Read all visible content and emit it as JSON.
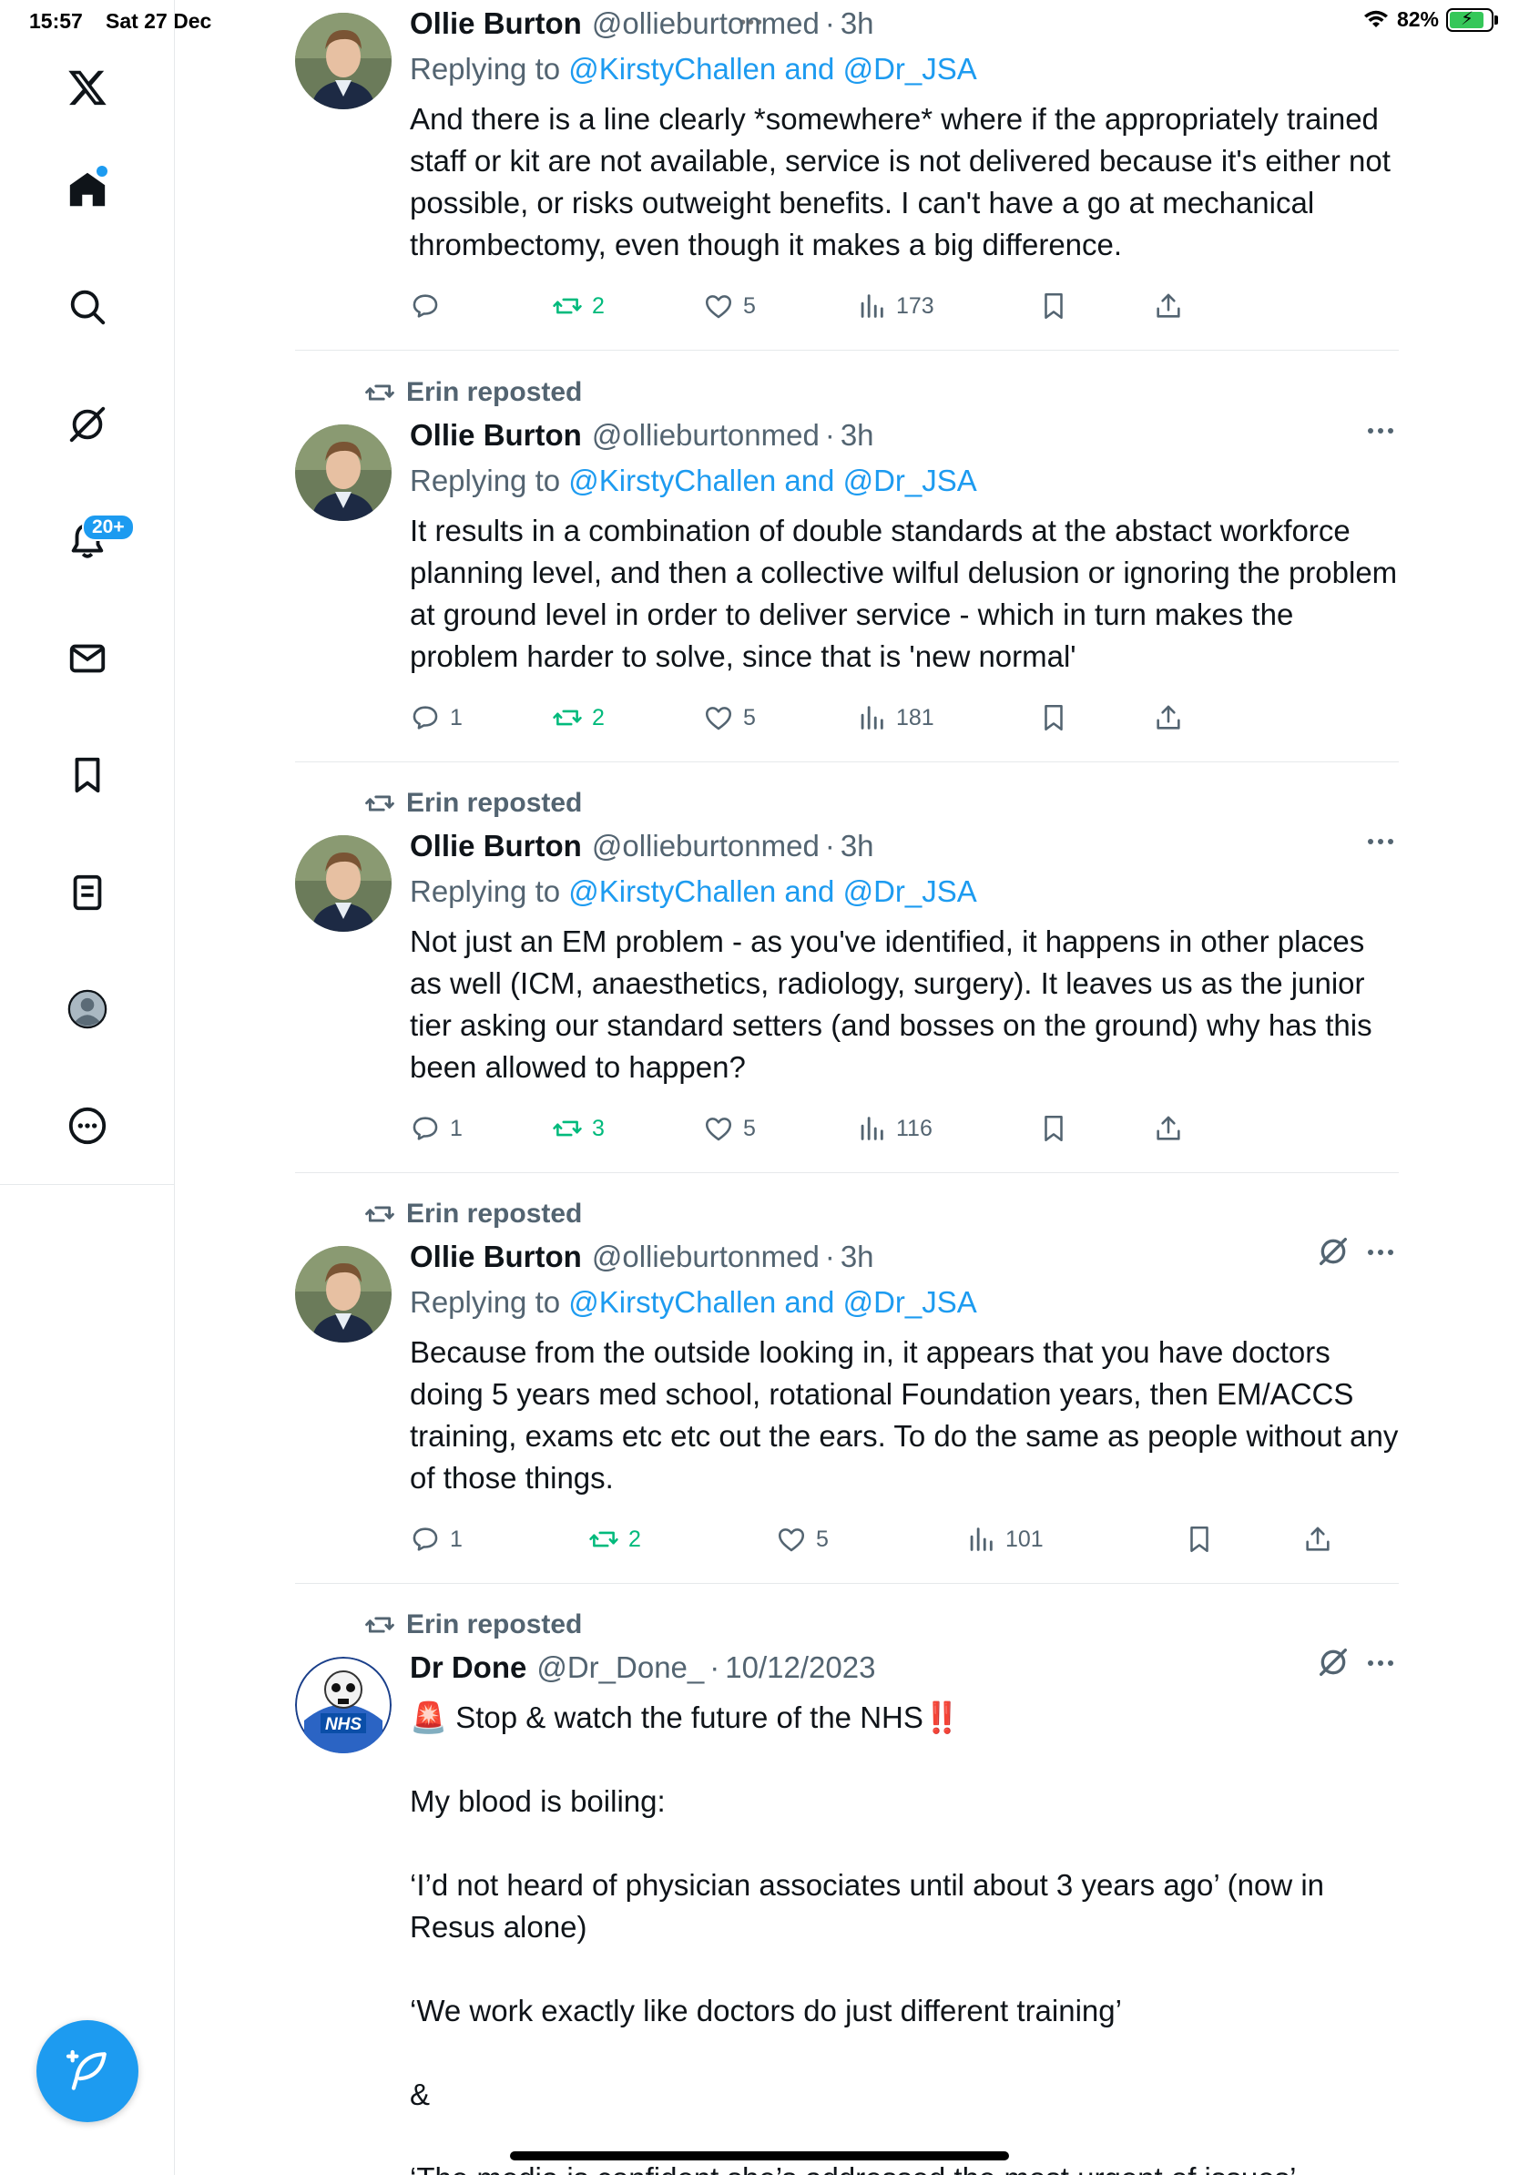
{
  "status": {
    "time": "15:57",
    "date": "Sat 27 Dec",
    "battery": "82%"
  },
  "nav": {
    "items": [
      "x-logo",
      "home",
      "search",
      "grok",
      "notifications",
      "messages",
      "bookmarks",
      "lists",
      "profile",
      "more"
    ],
    "notif_badge": "20+"
  },
  "tweets": [
    {
      "reposted_by": "",
      "name": "Ollie Burton",
      "handle": "@ollieburtonmed",
      "time": "3h",
      "reply_prefix": "Replying to ",
      "reply_to": "@KirstyChallen and @Dr_JSA",
      "text": "And there is a line clearly *somewhere* where if the appropriately trained staff or kit are not available, service is not delivered because it's either not possible, or risks outweight benefits. I can't have a go at mechanical thrombectomy, even though it makes a big difference.",
      "replies": "",
      "reposts": "2",
      "likes": "5",
      "views": "173"
    },
    {
      "reposted_by": "Erin reposted",
      "name": "Ollie Burton",
      "handle": "@ollieburtonmed",
      "time": "3h",
      "reply_prefix": "Replying to ",
      "reply_to": "@KirstyChallen and @Dr_JSA",
      "text": "It results in a combination of double standards at the abstact workforce planning level, and then a collective wilful delusion or ignoring the problem at ground level in order to deliver service - which in turn makes the problem harder to solve, since that is 'new normal'",
      "replies": "1",
      "reposts": "2",
      "likes": "5",
      "views": "181"
    },
    {
      "reposted_by": "Erin reposted",
      "name": "Ollie Burton",
      "handle": "@ollieburtonmed",
      "time": "3h",
      "reply_prefix": "Replying to ",
      "reply_to": "@KirstyChallen and @Dr_JSA",
      "text": "Not just an EM problem - as you've identified, it happens in other places as well (ICM, anaesthetics, radiology, surgery). It leaves us as the junior tier asking our standard setters (and bosses on the ground) why has this been allowed to happen?",
      "replies": "1",
      "reposts": "3",
      "likes": "5",
      "views": "116"
    },
    {
      "reposted_by": "Erin reposted",
      "name": "Ollie Burton",
      "handle": "@ollieburtonmed",
      "time": "3h",
      "reply_prefix": "Replying to ",
      "reply_to": "@KirstyChallen and @Dr_JSA",
      "text": "Because from the outside looking in, it appears that you have doctors doing 5 years med school, rotational Foundation years, then EM/ACCS training, exams etc etc out the ears. To do the same as people without any of those things.",
      "replies": "1",
      "reposts": "2",
      "likes": "5",
      "views": "101"
    },
    {
      "reposted_by": "Erin reposted",
      "name": "Dr Done",
      "handle": "@Dr_Done_",
      "time": "10/12/2023",
      "reply_prefix": "",
      "reply_to": "",
      "text": "🚨 Stop & watch the future of the NHS‼️\n\nMy blood is boiling:\n\n‘I’d not heard of physician associates until about 3 years ago’ (now in Resus alone)\n\n‘We work exactly like doctors do just different training’\n\n&\n\n‘The media is confident she’s addressed the most urgent of issues’",
      "replies": "",
      "reposts": "",
      "likes": "",
      "views": ""
    }
  ],
  "colors": {
    "accent": "#1d9bf0",
    "repost_green": "#00ba7c",
    "muted": "#536471",
    "text": "#0f1419"
  }
}
